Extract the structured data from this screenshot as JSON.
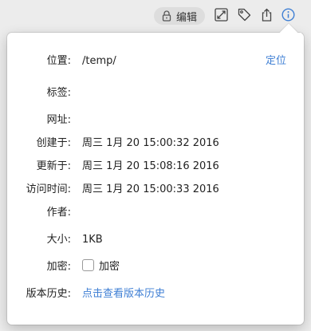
{
  "toolbar": {
    "edit_label": "编辑",
    "icons": [
      "lock-icon",
      "expand-icon",
      "tag-icon",
      "share-icon",
      "info-icon"
    ],
    "accent_color": "#3f7fd4"
  },
  "info": {
    "location": {
      "label": "位置:",
      "value": "/temp/",
      "action": "定位"
    },
    "tags": {
      "label": "标签:"
    },
    "url": {
      "label": "网址:"
    },
    "created": {
      "label": "创建于:",
      "value": "周三 1月 20 15:00:32 2016"
    },
    "updated": {
      "label": "更新于:",
      "value": "周三 1月 20 15:08:16 2016"
    },
    "accessed": {
      "label": "访问时间:",
      "value": "周三 1月 20 15:00:33 2016"
    },
    "author": {
      "label": "作者:"
    },
    "size": {
      "label": "大小:",
      "value": "1KB"
    },
    "encrypt": {
      "label": "加密:",
      "checkbox_label": "加密",
      "checked": false
    },
    "history": {
      "label": "版本历史:",
      "link": "点击查看版本历史"
    }
  }
}
